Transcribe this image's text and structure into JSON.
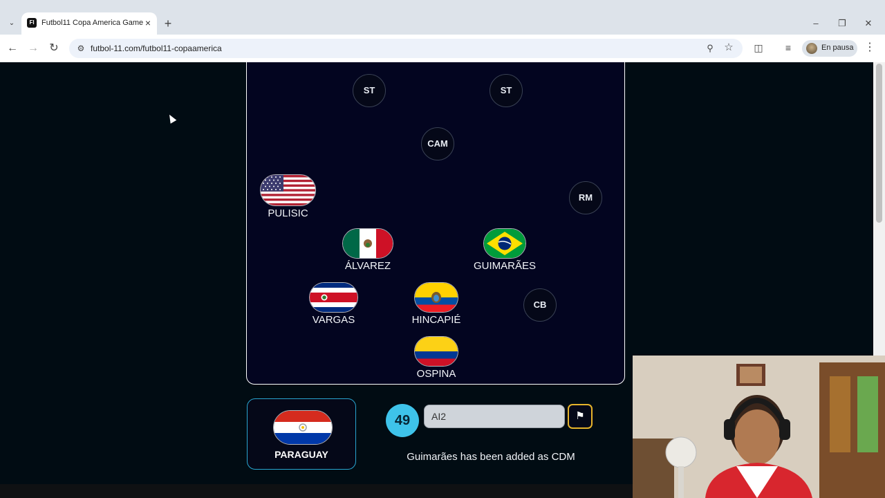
{
  "browser": {
    "tab_title": "Futbol11 Copa America Game",
    "favicon_text": "FI",
    "url": "futbol-11.com/futbol11-copaamerica",
    "profile_label": "En pausa",
    "icons": {
      "tab_search": "chevron-down-icon",
      "tab_close": "close-icon",
      "new_tab": "plus-icon",
      "back": "arrow-left-icon",
      "forward": "arrow-right-icon",
      "reload": "reload-icon",
      "site_info": "tune-icon",
      "zoom": "zoom-icon",
      "bookmark": "star-icon",
      "extensions": "puzzle-icon",
      "media": "media-control-icon",
      "menu": "kebab-menu-icon",
      "minimize": "minimize-icon",
      "restore": "restore-icon",
      "close_window": "close-icon"
    }
  },
  "pitch": {
    "empty_slots": [
      {
        "label": "ST"
      },
      {
        "label": "ST"
      },
      {
        "label": "CAM"
      },
      {
        "label": "RM"
      },
      {
        "label": "CB"
      }
    ],
    "players": [
      {
        "name": "PULISIC",
        "flag": "usa"
      },
      {
        "name": "ÁLVAREZ",
        "flag": "mexico"
      },
      {
        "name": "GUIMARÃES",
        "flag": "brazil"
      },
      {
        "name": "VARGAS",
        "flag": "costa-rica"
      },
      {
        "name": "HINCAPIÉ",
        "flag": "ecuador"
      },
      {
        "name": "OSPINA",
        "flag": "colombia"
      }
    ]
  },
  "game": {
    "nation": {
      "name": "PARAGUAY",
      "flag": "paraguay"
    },
    "counter": "49",
    "guess_value": "AI2",
    "flag_button_icon": "flag-icon",
    "status_message": "Guimarães has been added as CDM"
  },
  "colors": {
    "page_bg": "#010c13",
    "pitch_bg": "#030520",
    "accent_cyan": "#3ec3ea",
    "accent_gold": "#e7b42b"
  }
}
